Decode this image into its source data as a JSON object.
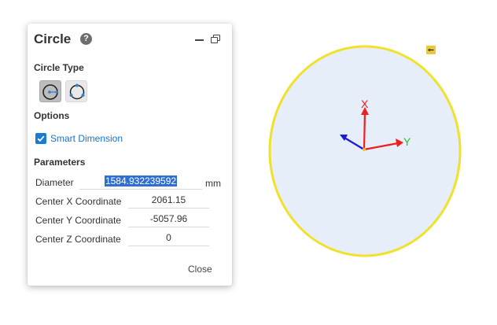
{
  "dialog": {
    "title": "Circle",
    "help_glyph": "?",
    "circle_type_label": "Circle Type",
    "options_label": "Options",
    "smart_dimension_label": "Smart Dimension",
    "smart_dimension_checked": true,
    "parameters_label": "Parameters",
    "diameter_label": "Diameter",
    "diameter_value": "1584.932239592",
    "diameter_unit": "mm",
    "center_x_label": "Center X Coordinate",
    "center_x_value": "2061.15",
    "center_y_label": "Center Y Coordinate",
    "center_y_value": "-5057.96",
    "center_z_label": "Center Z Coordinate",
    "center_z_value": "0",
    "close_label": "Close"
  },
  "viewport": {
    "axis_x_label": "X",
    "axis_y_label": "Y",
    "circle_fill": "#e6eefa",
    "circle_stroke": "#f2e12a",
    "x_axis_color": "#f01e1e",
    "y_axis_color": "#2bbf2b",
    "z_axis_color": "#1a1ad6",
    "handle_icon": "dimension-handle-icon"
  }
}
